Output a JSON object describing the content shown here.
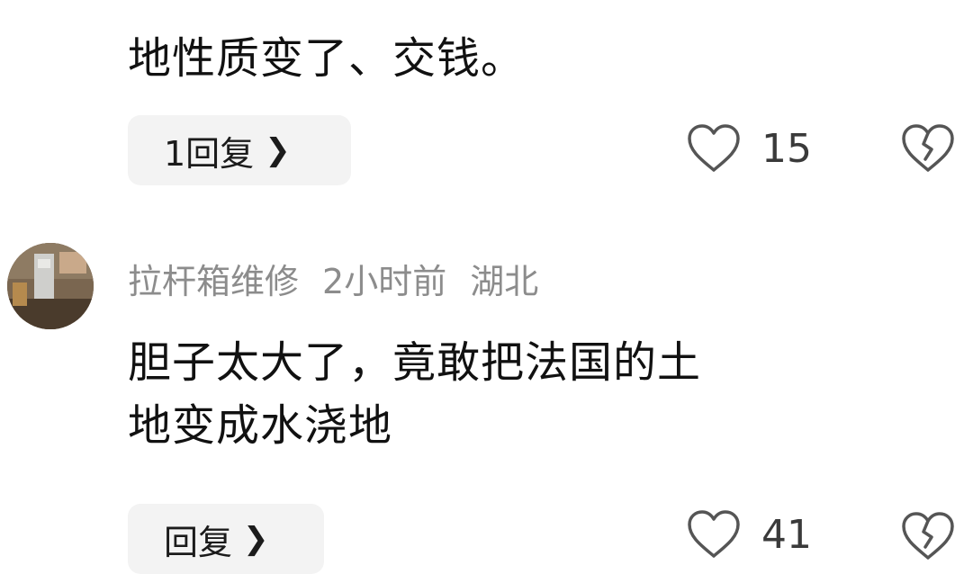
{
  "previous_comment": {
    "text_tail": "地性质变了、交钱。",
    "reply_label": "1回复",
    "like_count": "15"
  },
  "comment": {
    "username": "拉杆箱维修",
    "time": "2小时前",
    "location": "湖北",
    "text": "胆子太大了，竟敢把法国的土\n地变成水浇地",
    "reply_label": "回复",
    "like_count": "41"
  },
  "icons": {
    "like": "heart-outline-icon",
    "dislike": "broken-heart-icon",
    "chevron": "chevron-right-icon"
  },
  "colors": {
    "text": "#111111",
    "meta": "#8c8c8c",
    "pill_bg": "#f3f3f3",
    "icon": "#555555"
  }
}
